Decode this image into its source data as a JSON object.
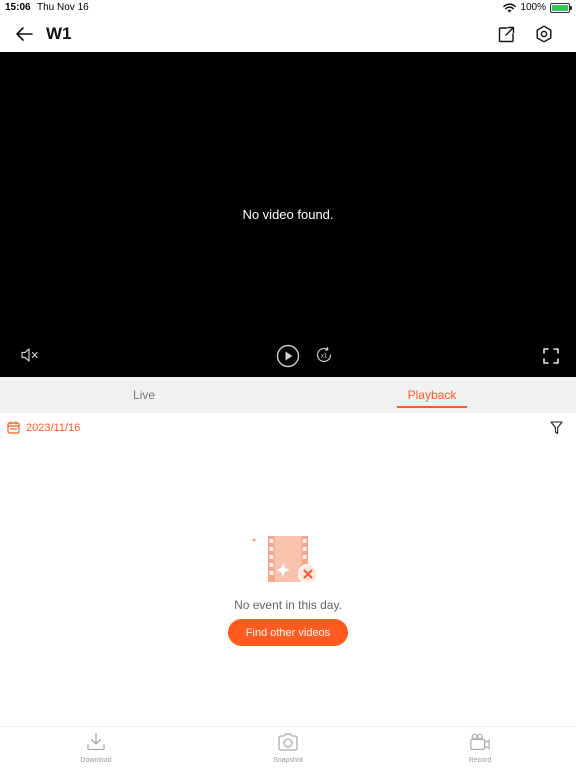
{
  "status_bar": {
    "time": "15:06",
    "date": "Thu Nov 16",
    "battery": "100%",
    "battery_level": 1.0
  },
  "nav": {
    "title": "W1",
    "icons": {
      "back": "arrow-left-icon",
      "share": "share-external-icon",
      "settings": "gear-icon"
    }
  },
  "video": {
    "message": "No video found.",
    "controls": {
      "mute": "speaker-muted-icon",
      "play": "play-circle-icon",
      "speed": "speed-x1-icon",
      "speed_label": "x1",
      "fullscreen": "fullscreen-icon"
    }
  },
  "tabs": [
    {
      "label": "Live",
      "active": false
    },
    {
      "label": "Playback",
      "active": true
    }
  ],
  "playback": {
    "date": "2023/11/16",
    "empty_message": "No event in this day.",
    "find_button": "Find other videos"
  },
  "bottom_bar": [
    {
      "label": "Download",
      "icon": "download-icon"
    },
    {
      "label": "Snapshot",
      "icon": "camera-icon"
    },
    {
      "label": "Record",
      "icon": "video-camera-icon"
    }
  ],
  "colors": {
    "accent": "#ff5a1f",
    "video_bg": "#000000",
    "tab_bg": "#f1f1f1",
    "muted_text": "#999999",
    "battery_green": "#34c759"
  }
}
